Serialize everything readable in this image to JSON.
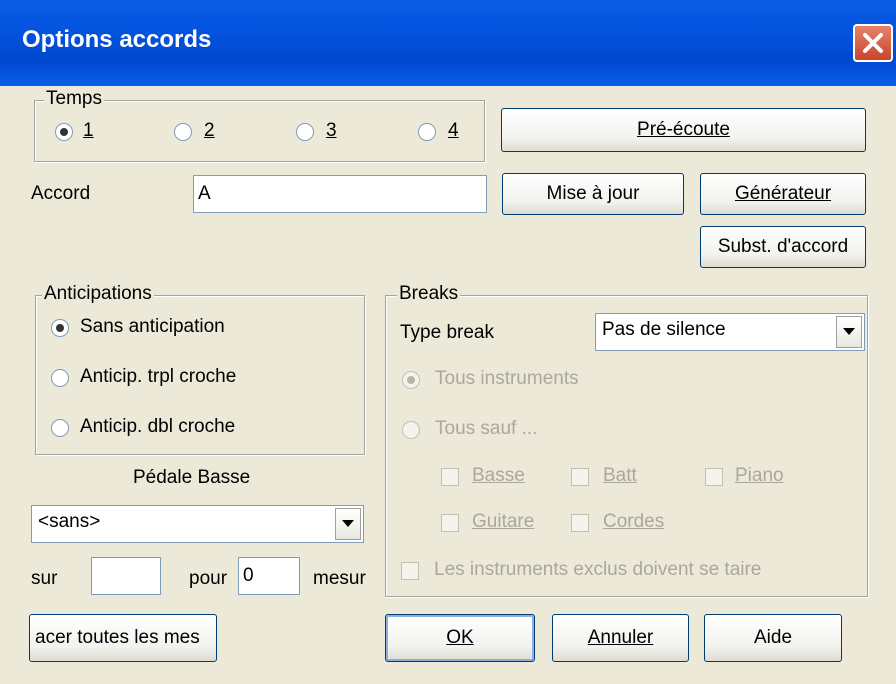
{
  "window": {
    "title": "Options accords",
    "close_icon": "close-icon"
  },
  "temps": {
    "legend": "Temps",
    "options": [
      "1",
      "2",
      "3",
      "4"
    ],
    "selected": "1"
  },
  "buttons": {
    "preecoute": "Pré-écoute",
    "mise_a_jour": "Mise à jour",
    "generateur": "Générateur",
    "subst": "Subst. d'accord",
    "placer": "acer toutes les mes",
    "ok": "OK",
    "annuler": "Annuler",
    "aide": "Aide"
  },
  "accord": {
    "label": "Accord",
    "value": "A"
  },
  "anticipations": {
    "legend": "Anticipations",
    "options": [
      "Sans anticipation",
      "Anticip. trpl croche",
      "Anticip. dbl croche"
    ],
    "selected": "Sans anticipation"
  },
  "pedale": {
    "label": "Pédale Basse",
    "value": "<sans>",
    "sur_label": "sur",
    "sur_value": "",
    "pour_label": "pour",
    "pour_value": "0",
    "mesures_label": "mesur"
  },
  "breaks": {
    "legend": "Breaks",
    "type_label": "Type break",
    "type_value": "Pas de silence",
    "tous_instruments": "Tous instruments",
    "tous_sauf": "Tous sauf ...",
    "instruments": [
      "Basse",
      "Batt",
      "Piano",
      "Guitare",
      "Cordes"
    ],
    "exclus": "Les instruments exclus doivent se taire"
  }
}
